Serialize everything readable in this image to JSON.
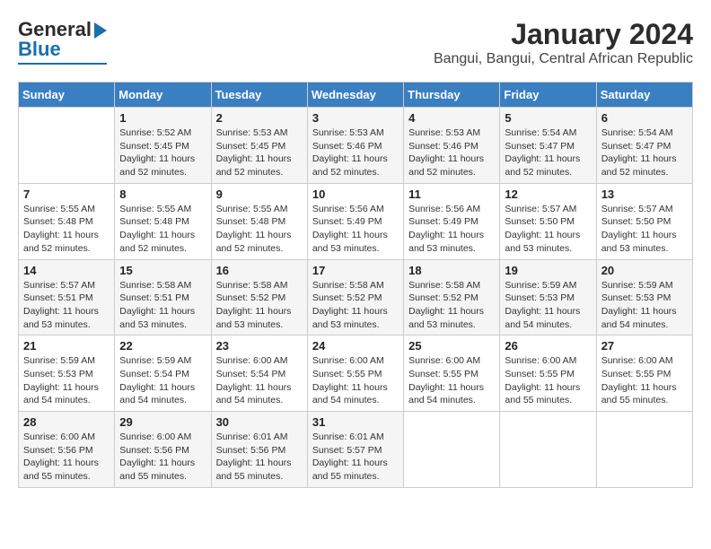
{
  "header": {
    "logo_line1": "General",
    "logo_line2": "Blue",
    "title": "January 2024",
    "subtitle": "Bangui, Bangui, Central African Republic"
  },
  "days_of_week": [
    "Sunday",
    "Monday",
    "Tuesday",
    "Wednesday",
    "Thursday",
    "Friday",
    "Saturday"
  ],
  "weeks": [
    [
      {
        "day": "",
        "info": ""
      },
      {
        "day": "1",
        "info": "Sunrise: 5:52 AM\nSunset: 5:45 PM\nDaylight: 11 hours\nand 52 minutes."
      },
      {
        "day": "2",
        "info": "Sunrise: 5:53 AM\nSunset: 5:45 PM\nDaylight: 11 hours\nand 52 minutes."
      },
      {
        "day": "3",
        "info": "Sunrise: 5:53 AM\nSunset: 5:46 PM\nDaylight: 11 hours\nand 52 minutes."
      },
      {
        "day": "4",
        "info": "Sunrise: 5:53 AM\nSunset: 5:46 PM\nDaylight: 11 hours\nand 52 minutes."
      },
      {
        "day": "5",
        "info": "Sunrise: 5:54 AM\nSunset: 5:47 PM\nDaylight: 11 hours\nand 52 minutes."
      },
      {
        "day": "6",
        "info": "Sunrise: 5:54 AM\nSunset: 5:47 PM\nDaylight: 11 hours\nand 52 minutes."
      }
    ],
    [
      {
        "day": "7",
        "info": "Sunrise: 5:55 AM\nSunset: 5:48 PM\nDaylight: 11 hours\nand 52 minutes."
      },
      {
        "day": "8",
        "info": "Sunrise: 5:55 AM\nSunset: 5:48 PM\nDaylight: 11 hours\nand 52 minutes."
      },
      {
        "day": "9",
        "info": "Sunrise: 5:55 AM\nSunset: 5:48 PM\nDaylight: 11 hours\nand 52 minutes."
      },
      {
        "day": "10",
        "info": "Sunrise: 5:56 AM\nSunset: 5:49 PM\nDaylight: 11 hours\nand 53 minutes."
      },
      {
        "day": "11",
        "info": "Sunrise: 5:56 AM\nSunset: 5:49 PM\nDaylight: 11 hours\nand 53 minutes."
      },
      {
        "day": "12",
        "info": "Sunrise: 5:57 AM\nSunset: 5:50 PM\nDaylight: 11 hours\nand 53 minutes."
      },
      {
        "day": "13",
        "info": "Sunrise: 5:57 AM\nSunset: 5:50 PM\nDaylight: 11 hours\nand 53 minutes."
      }
    ],
    [
      {
        "day": "14",
        "info": "Sunrise: 5:57 AM\nSunset: 5:51 PM\nDaylight: 11 hours\nand 53 minutes."
      },
      {
        "day": "15",
        "info": "Sunrise: 5:58 AM\nSunset: 5:51 PM\nDaylight: 11 hours\nand 53 minutes."
      },
      {
        "day": "16",
        "info": "Sunrise: 5:58 AM\nSunset: 5:52 PM\nDaylight: 11 hours\nand 53 minutes."
      },
      {
        "day": "17",
        "info": "Sunrise: 5:58 AM\nSunset: 5:52 PM\nDaylight: 11 hours\nand 53 minutes."
      },
      {
        "day": "18",
        "info": "Sunrise: 5:58 AM\nSunset: 5:52 PM\nDaylight: 11 hours\nand 53 minutes."
      },
      {
        "day": "19",
        "info": "Sunrise: 5:59 AM\nSunset: 5:53 PM\nDaylight: 11 hours\nand 54 minutes."
      },
      {
        "day": "20",
        "info": "Sunrise: 5:59 AM\nSunset: 5:53 PM\nDaylight: 11 hours\nand 54 minutes."
      }
    ],
    [
      {
        "day": "21",
        "info": "Sunrise: 5:59 AM\nSunset: 5:53 PM\nDaylight: 11 hours\nand 54 minutes."
      },
      {
        "day": "22",
        "info": "Sunrise: 5:59 AM\nSunset: 5:54 PM\nDaylight: 11 hours\nand 54 minutes."
      },
      {
        "day": "23",
        "info": "Sunrise: 6:00 AM\nSunset: 5:54 PM\nDaylight: 11 hours\nand 54 minutes."
      },
      {
        "day": "24",
        "info": "Sunrise: 6:00 AM\nSunset: 5:55 PM\nDaylight: 11 hours\nand 54 minutes."
      },
      {
        "day": "25",
        "info": "Sunrise: 6:00 AM\nSunset: 5:55 PM\nDaylight: 11 hours\nand 54 minutes."
      },
      {
        "day": "26",
        "info": "Sunrise: 6:00 AM\nSunset: 5:55 PM\nDaylight: 11 hours\nand 55 minutes."
      },
      {
        "day": "27",
        "info": "Sunrise: 6:00 AM\nSunset: 5:55 PM\nDaylight: 11 hours\nand 55 minutes."
      }
    ],
    [
      {
        "day": "28",
        "info": "Sunrise: 6:00 AM\nSunset: 5:56 PM\nDaylight: 11 hours\nand 55 minutes."
      },
      {
        "day": "29",
        "info": "Sunrise: 6:00 AM\nSunset: 5:56 PM\nDaylight: 11 hours\nand 55 minutes."
      },
      {
        "day": "30",
        "info": "Sunrise: 6:01 AM\nSunset: 5:56 PM\nDaylight: 11 hours\nand 55 minutes."
      },
      {
        "day": "31",
        "info": "Sunrise: 6:01 AM\nSunset: 5:57 PM\nDaylight: 11 hours\nand 55 minutes."
      },
      {
        "day": "",
        "info": ""
      },
      {
        "day": "",
        "info": ""
      },
      {
        "day": "",
        "info": ""
      }
    ]
  ]
}
